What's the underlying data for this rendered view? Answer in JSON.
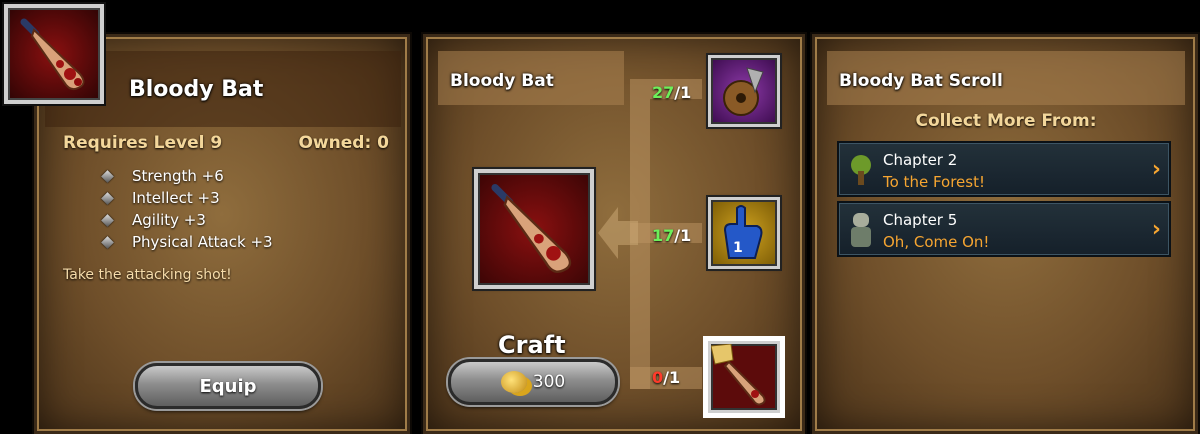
{
  "item": {
    "name": "Bloody Bat",
    "requires": "Requires Level 9",
    "owned": "Owned: 0",
    "stats": [
      "Strength +6",
      "Intellect +3",
      "Agility +3",
      "Physical Attack +3"
    ],
    "flavor": "Take the attacking shot!",
    "equip_label": "Equip"
  },
  "craft": {
    "title": "Bloody Bat",
    "craft_label": "Craft",
    "cost": "300",
    "ingredients": [
      {
        "name": "bell-horn-ingredient",
        "have": "27",
        "need": "/1"
      },
      {
        "name": "foam-finger-ingredient",
        "have": "17",
        "need": "/1"
      },
      {
        "name": "bloody-bat-scroll-ingredient",
        "have": "0",
        "need": "/1"
      }
    ]
  },
  "scroll": {
    "title": "Bloody Bat Scroll",
    "collect_label": "Collect More From:",
    "sources": [
      {
        "chapter": "Chapter 2",
        "stage": "To the Forest!"
      },
      {
        "chapter": "Chapter 5",
        "stage": "Oh, Come On!"
      }
    ]
  },
  "colors": {
    "have_ok": "#6cf05a",
    "have_missing": "#ff3a2a",
    "stage_text": "#f6a531"
  }
}
